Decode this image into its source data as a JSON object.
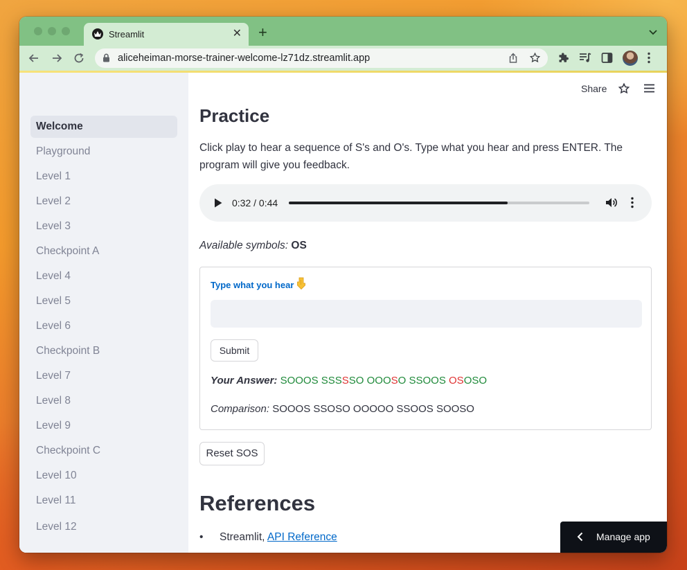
{
  "browser": {
    "tab_title": "Streamlit",
    "url": "aliceheiman-morse-trainer-welcome-lz71dz.streamlit.app",
    "accent_color": "#81c184"
  },
  "sidebar": {
    "items": [
      {
        "label": "Welcome",
        "active": true
      },
      {
        "label": "Playground"
      },
      {
        "label": "Level 1"
      },
      {
        "label": "Level 2"
      },
      {
        "label": "Level 3"
      },
      {
        "label": "Checkpoint A"
      },
      {
        "label": "Level 4"
      },
      {
        "label": "Level 5"
      },
      {
        "label": "Level 6"
      },
      {
        "label": "Checkpoint B"
      },
      {
        "label": "Level 7"
      },
      {
        "label": "Level 8"
      },
      {
        "label": "Level 9"
      },
      {
        "label": "Checkpoint C"
      },
      {
        "label": "Level 10"
      },
      {
        "label": "Level 11"
      },
      {
        "label": "Level 12"
      }
    ]
  },
  "header": {
    "share_label": "Share"
  },
  "main": {
    "practice_title": "Practice",
    "intro_text": "Click play to hear a sequence of S's and O's. Type what you hear and press ENTER. The program will give you feedback.",
    "audio": {
      "time_display": "0:32 / 0:44",
      "progress": 0.727
    },
    "symbols_label": "Available symbols:",
    "symbols_value": "OS",
    "form": {
      "input_label": "Type what you hear",
      "input_emoji": "point-down-emoji",
      "input_value": "",
      "submit_label": "Submit"
    },
    "answer_label": "Your Answer:",
    "answer_segments": [
      {
        "text": "SOOOS ",
        "status": "correct"
      },
      {
        "text": "SSS",
        "status": "correct"
      },
      {
        "text": "S",
        "status": "wrong"
      },
      {
        "text": "SO OOO",
        "status": "correct"
      },
      {
        "text": "S",
        "status": "wrong"
      },
      {
        "text": "O SSOOS ",
        "status": "correct"
      },
      {
        "text": "OS",
        "status": "wrong"
      },
      {
        "text": "OSO",
        "status": "correct"
      }
    ],
    "comparison_label": "Comparison:",
    "comparison_value": "SOOOS SSOSO OOOOO SSOOS SOOSO",
    "reset_label": "Reset SOS",
    "references_title": "References",
    "reference_prefix": "Streamlit, ",
    "reference_link": "API Reference"
  },
  "manage_app_label": "Manage app"
}
